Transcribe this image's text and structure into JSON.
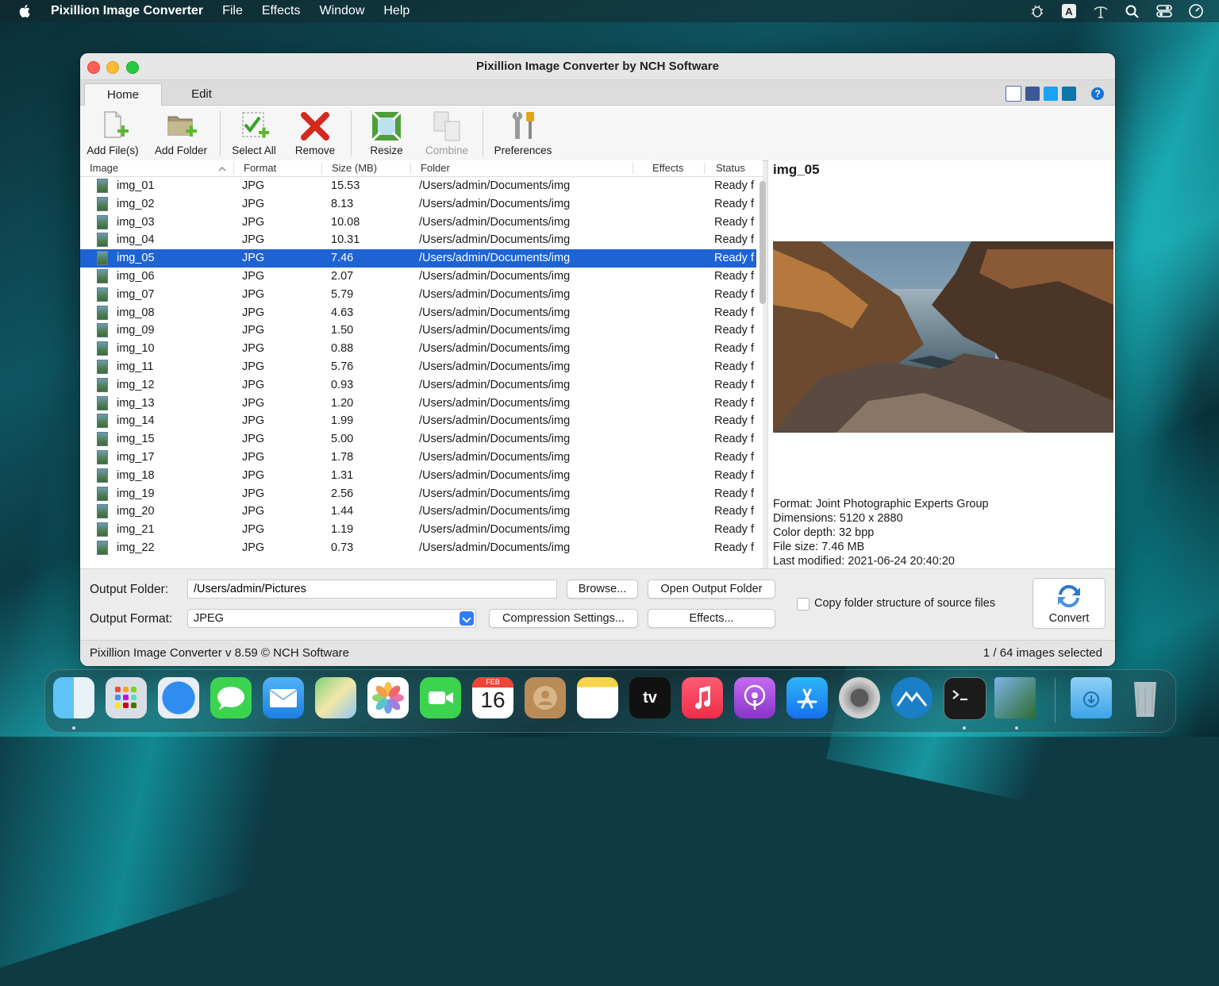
{
  "menubar": {
    "app_name": "Pixillion Image Converter",
    "items": [
      "File",
      "Effects",
      "Window",
      "Help"
    ],
    "status_icons": [
      "bug-icon",
      "input-source-icon",
      "accessibility-icon",
      "search-icon",
      "control-center-icon",
      "clock-icon"
    ],
    "input_source_letter": "A"
  },
  "window": {
    "title": "Pixillion Image Converter by NCH Software",
    "tabs": [
      "Home",
      "Edit"
    ],
    "help_glyph": "?"
  },
  "toolbar": {
    "add_files": "Add File(s)",
    "add_folder": "Add Folder",
    "select_all": "Select All",
    "remove": "Remove",
    "resize": "Resize",
    "combine": "Combine",
    "preferences": "Preferences"
  },
  "table": {
    "headers": {
      "image": "Image",
      "format": "Format",
      "size": "Size (MB)",
      "folder": "Folder",
      "effects": "Effects",
      "status": "Status"
    },
    "selected_index": 4,
    "rows": [
      {
        "name": "img_01",
        "format": "JPG",
        "size": "15.53",
        "folder": "/Users/admin/Documents/img",
        "effects": "",
        "status": "Ready f"
      },
      {
        "name": "img_02",
        "format": "JPG",
        "size": "8.13",
        "folder": "/Users/admin/Documents/img",
        "effects": "",
        "status": "Ready f"
      },
      {
        "name": "img_03",
        "format": "JPG",
        "size": "10.08",
        "folder": "/Users/admin/Documents/img",
        "effects": "",
        "status": "Ready f"
      },
      {
        "name": "img_04",
        "format": "JPG",
        "size": "10.31",
        "folder": "/Users/admin/Documents/img",
        "effects": "",
        "status": "Ready f"
      },
      {
        "name": "img_05",
        "format": "JPG",
        "size": "7.46",
        "folder": "/Users/admin/Documents/img",
        "effects": "",
        "status": "Ready f"
      },
      {
        "name": "img_06",
        "format": "JPG",
        "size": "2.07",
        "folder": "/Users/admin/Documents/img",
        "effects": "",
        "status": "Ready f"
      },
      {
        "name": "img_07",
        "format": "JPG",
        "size": "5.79",
        "folder": "/Users/admin/Documents/img",
        "effects": "",
        "status": "Ready f"
      },
      {
        "name": "img_08",
        "format": "JPG",
        "size": "4.63",
        "folder": "/Users/admin/Documents/img",
        "effects": "",
        "status": "Ready f"
      },
      {
        "name": "img_09",
        "format": "JPG",
        "size": "1.50",
        "folder": "/Users/admin/Documents/img",
        "effects": "",
        "status": "Ready f"
      },
      {
        "name": "img_10",
        "format": "JPG",
        "size": "0.88",
        "folder": "/Users/admin/Documents/img",
        "effects": "",
        "status": "Ready f"
      },
      {
        "name": "img_11",
        "format": "JPG",
        "size": "5.76",
        "folder": "/Users/admin/Documents/img",
        "effects": "",
        "status": "Ready f"
      },
      {
        "name": "img_12",
        "format": "JPG",
        "size": "0.93",
        "folder": "/Users/admin/Documents/img",
        "effects": "",
        "status": "Ready f"
      },
      {
        "name": "img_13",
        "format": "JPG",
        "size": "1.20",
        "folder": "/Users/admin/Documents/img",
        "effects": "",
        "status": "Ready f"
      },
      {
        "name": "img_14",
        "format": "JPG",
        "size": "1.99",
        "folder": "/Users/admin/Documents/img",
        "effects": "",
        "status": "Ready f"
      },
      {
        "name": "img_15",
        "format": "JPG",
        "size": "5.00",
        "folder": "/Users/admin/Documents/img",
        "effects": "",
        "status": "Ready f"
      },
      {
        "name": "img_17",
        "format": "JPG",
        "size": "1.78",
        "folder": "/Users/admin/Documents/img",
        "effects": "",
        "status": "Ready f"
      },
      {
        "name": "img_18",
        "format": "JPG",
        "size": "1.31",
        "folder": "/Users/admin/Documents/img",
        "effects": "",
        "status": "Ready f"
      },
      {
        "name": "img_19",
        "format": "JPG",
        "size": "2.56",
        "folder": "/Users/admin/Documents/img",
        "effects": "",
        "status": "Ready f"
      },
      {
        "name": "img_20",
        "format": "JPG",
        "size": "1.44",
        "folder": "/Users/admin/Documents/img",
        "effects": "",
        "status": "Ready f"
      },
      {
        "name": "img_21",
        "format": "JPG",
        "size": "1.19",
        "folder": "/Users/admin/Documents/img",
        "effects": "",
        "status": "Ready f"
      },
      {
        "name": "img_22",
        "format": "JPG",
        "size": "0.73",
        "folder": "/Users/admin/Documents/img",
        "effects": "",
        "status": "Ready f"
      }
    ]
  },
  "preview": {
    "title": "img_05",
    "format": "Format: Joint Photographic Experts Group",
    "dimensions": "Dimensions: 5120 x 2880",
    "color_depth": "Color depth: 32 bpp",
    "file_size": "File size: 7.46 MB",
    "last_modified": "Last modified: 2021-06-24 20:40:20"
  },
  "output": {
    "folder_label": "Output Folder:",
    "folder_value": "/Users/admin/Pictures",
    "format_label": "Output Format:",
    "format_value": "JPEG",
    "browse": "Browse...",
    "open_output": "Open Output Folder",
    "compression": "Compression Settings...",
    "effects": "Effects...",
    "copy_structure": "Copy folder structure of source files",
    "copy_structure_checked": false,
    "convert": "Convert"
  },
  "status": {
    "left": "Pixillion Image Converter v 8.59 © NCH Software",
    "right": "1 / 64 images selected"
  },
  "dock": {
    "apps": [
      "finder-icon",
      "launchpad-icon",
      "safari-icon",
      "messages-icon",
      "mail-icon",
      "maps-icon",
      "photos-icon",
      "facetime-icon",
      "calendar-icon",
      "contacts-icon",
      "notes-icon",
      "tv-icon",
      "music-icon",
      "podcasts-icon",
      "app-store-icon",
      "system-preferences-icon",
      "altool-icon",
      "terminal-icon",
      "pixillion-icon",
      "downloads-folder-icon",
      "trash-icon"
    ],
    "calendar_month": "FEB",
    "calendar_day": "16",
    "tv_label": "tv"
  },
  "colors": {
    "selection": "#1e63d3",
    "accent": "#2f7cf6"
  }
}
